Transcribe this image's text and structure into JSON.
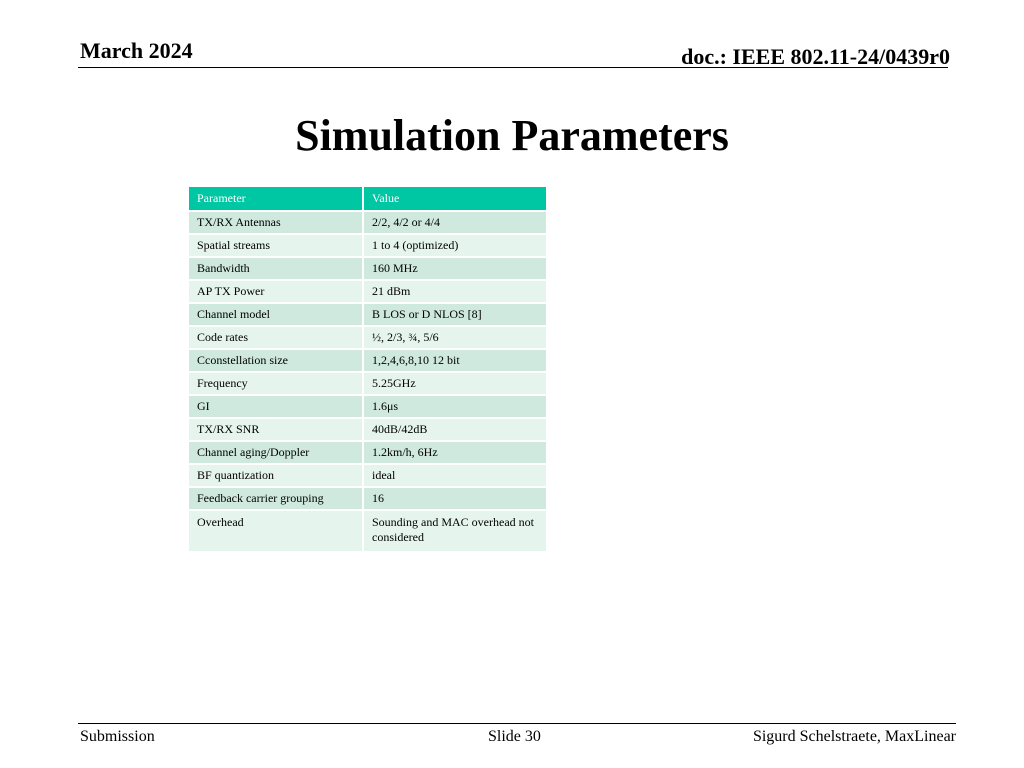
{
  "header": {
    "date": "March 2024",
    "doc_id": "doc.: IEEE 802.11-24/0439r0"
  },
  "title": "Simulation Parameters",
  "table": {
    "headers": [
      "Parameter",
      "Value"
    ],
    "rows": [
      [
        "TX/RX Antennas",
        "2/2, 4/2 or 4/4"
      ],
      [
        "Spatial streams",
        "1 to 4 (optimized)"
      ],
      [
        "Bandwidth",
        "160 MHz"
      ],
      [
        "AP TX Power",
        "21 dBm"
      ],
      [
        "Channel model",
        "B LOS or D NLOS [8]"
      ],
      [
        "Code rates",
        "½, 2/3, ¾, 5/6"
      ],
      [
        "Cconstellation size",
        "1,2,4,6,8,10 12 bit"
      ],
      [
        "Frequency",
        "5.25GHz"
      ],
      [
        "GI",
        "1.6μs"
      ],
      [
        "TX/RX SNR",
        "40dB/42dB"
      ],
      [
        "Channel aging/Doppler",
        "1.2km/h, 6Hz"
      ],
      [
        "BF quantization",
        "ideal"
      ],
      [
        "Feedback carrier grouping",
        "16"
      ],
      [
        "Overhead",
        "Sounding and MAC overhead not considered"
      ]
    ]
  },
  "footer": {
    "left": "Submission",
    "center": "Slide 30",
    "right": "Sigurd Schelstraete, MaxLinear"
  },
  "colors": {
    "table_header": "#00c7a3",
    "row_odd": "#cfe9df",
    "row_even": "#e6f4ee"
  }
}
